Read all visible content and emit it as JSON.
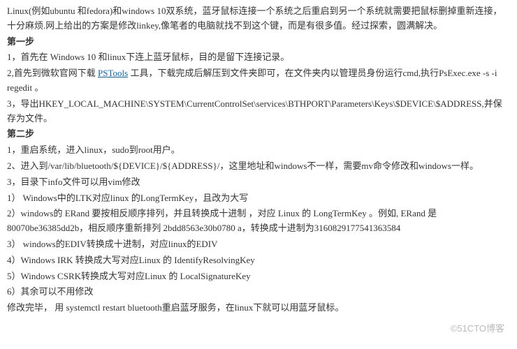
{
  "intro": "Linux(例如ubuntu 和fedora)和windows 10双系统，蓝牙鼠标连接一个系统之后重启到另一个系统就需要把鼠标删掉重新连接，十分麻烦.网上给出的方案是修改linkey,像笔者的电脑就找不到这个键，而是有很多值。经过探索，圆满解决。",
  "step1": {
    "title": "第一步",
    "item1": "1，首先在 Windows 10 和linux下连上蓝牙鼠标，目的是留下连接记录。",
    "item2_pre": "2,首先到微软官网下载 ",
    "item2_link": "PSTools",
    "item2_post": " 工具，下载完成后解压到文件夹即可，在文件夹内以管理员身份运行cmd,执行PsExec.exe -s -i regedit 。",
    "item3": "3，导出HKEY_LOCAL_MACHINE\\SYSTEM\\CurrentControlSet\\services\\BTHPORT\\Parameters\\Keys\\$DEVICE\\$ADDRESS,并保存为文件。"
  },
  "step2": {
    "title": "第二步",
    "item1": "1，重启系统，进入linux，sudo到root用户。",
    "item2": "2、进入到/var/lib/bluetooth/${DEVICE}/${ADDRESS}/，这里地址和windows不一样，需要mv命令修改和windows一样。",
    "item3": "3，目录下info文件可以用vim修改",
    "sub1": "1） Windows中的LTK对应linux 的LongTermKey，且改为大写",
    "sub2": "2）windows的 ERand 要按相反顺序排列，并且转换成十进制 ，对应 Linux 的 LongTermKey 。例如, ERand 是80070be36385dd2b，相反顺序重新排列 2bdd8563e30b0780 a，转换成十进制为3160829177541363584",
    "sub3": "3） windows的EDIV转换成十进制，对应linux的EDIV",
    "sub4": "4）Windows IRK 转换成大写对应Linux 的 IdentifyResolvingKey",
    "sub5": "5）Windows CSRK转换成大写对应Linux 的 LocalSignatureKey",
    "sub6": "6）其余可以不用修改",
    "final": "修改完毕， 用 systemctl restart bluetooth重启蓝牙服务，在linux下就可以用蓝牙鼠标。"
  },
  "watermark": "©51CTO博客"
}
